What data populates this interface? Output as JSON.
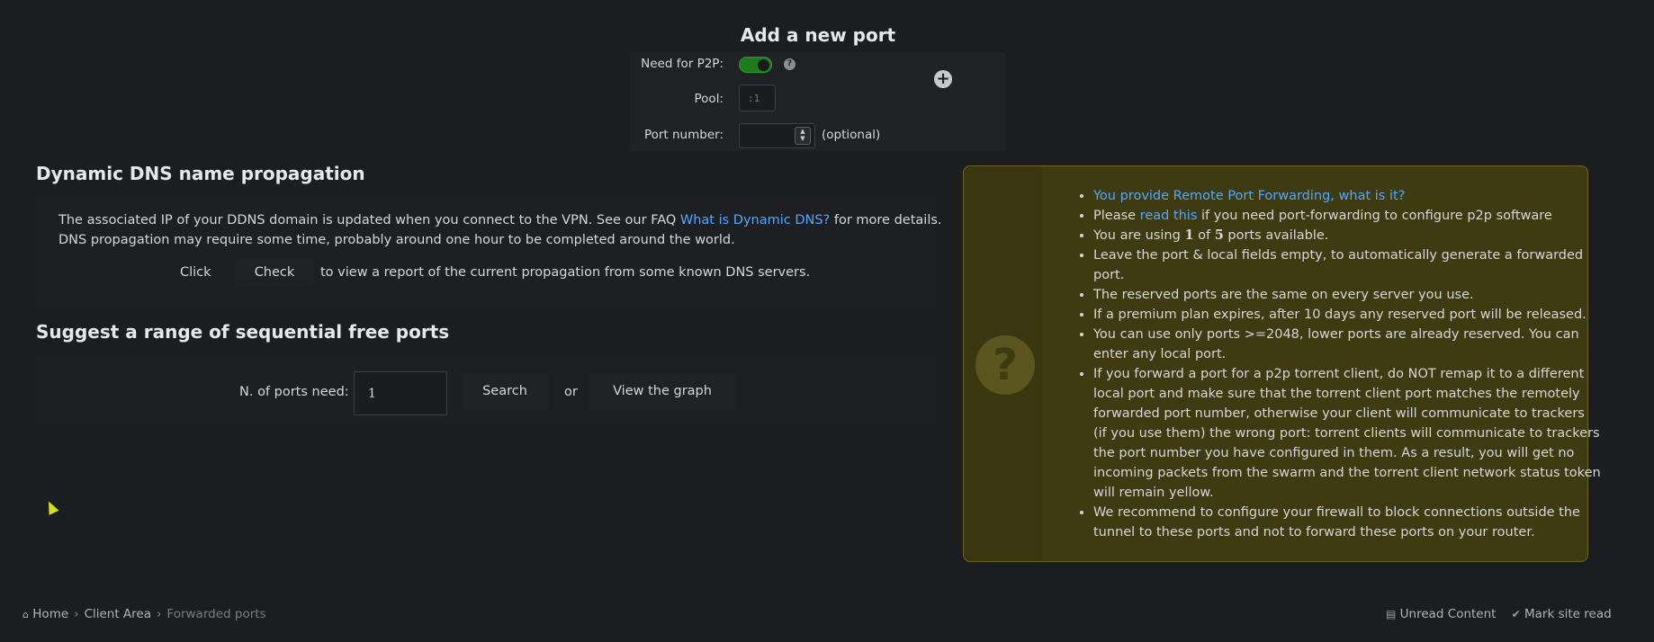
{
  "add_port": {
    "title": "Add a new port",
    "p2p_label": "Need for P2P:",
    "p2p_enabled": true,
    "help": "?",
    "pool_label": "Pool:",
    "pool_value": ":1",
    "port_label": "Port number:",
    "port_value": "",
    "optional": "(optional)",
    "add_icon": "plus-circle-icon",
    "add_symbol": "+"
  },
  "ddns": {
    "title": "Dynamic DNS name propagation",
    "line1_pre": "The associated IP of your DDNS domain is updated when you connect to the VPN. See our FAQ ",
    "line1_link": "What is Dynamic DNS?",
    "line1_post": " for more details.",
    "line2": "DNS propagation may require some time, probably around one hour to be completed around the world.",
    "click": "Click",
    "check_button": "Check",
    "line3": "to view a report of the current propagation from some known DNS servers."
  },
  "suggest": {
    "title": "Suggest a range of sequential free ports",
    "label": "N. of ports need:",
    "value": "1",
    "search_button": "Search",
    "or": "or",
    "graph_button": "View the graph"
  },
  "info": {
    "icon": "question-circle-icon",
    "icon_symbol": "?",
    "item1_link": "You provide Remote Port Forwarding, what is it?",
    "item2_pre": "Please ",
    "item2_link": "read this",
    "item2_post": " if you need port-forwarding to configure p2p software",
    "item3_pre": "You are using ",
    "item3_used": "1",
    "item3_mid": " of ",
    "item3_total": "5",
    "item3_post": " ports available.",
    "item4": "Leave the port & local fields empty, to automatically generate a forwarded port.",
    "item5": "The reserved ports are the same on every server you use.",
    "item6": "If a premium plan expires, after 10 days any reserved port will be released.",
    "item7": "You can use only ports >=2048, lower ports are already reserved. You can enter any local port.",
    "item8": "If you forward a port for a p2p torrent client, do NOT remap it to a different local port and make sure that the torrent client port matches the remotely forwarded port number, otherwise your client will communicate to trackers (if you use them) the wrong port: torrent clients will communicate to trackers the port number you have configured in them. As a result, you will get no incoming packets from the swarm and the torrent client network status token will remain yellow.",
    "item9": "We recommend to configure your firewall to block connections outside the tunnel to these ports and not to forward these ports on your router."
  },
  "footer": {
    "home_icon": "home-icon",
    "home": "Home",
    "client_area": "Client Area",
    "current": "Forwarded ports",
    "unread": "Unread Content",
    "mark_read": "Mark site read"
  },
  "colors": {
    "background": "#1b1d20",
    "link": "#54a8ff",
    "info_bg": "#3e3a11",
    "toggle_on": "#1d7b1d"
  }
}
